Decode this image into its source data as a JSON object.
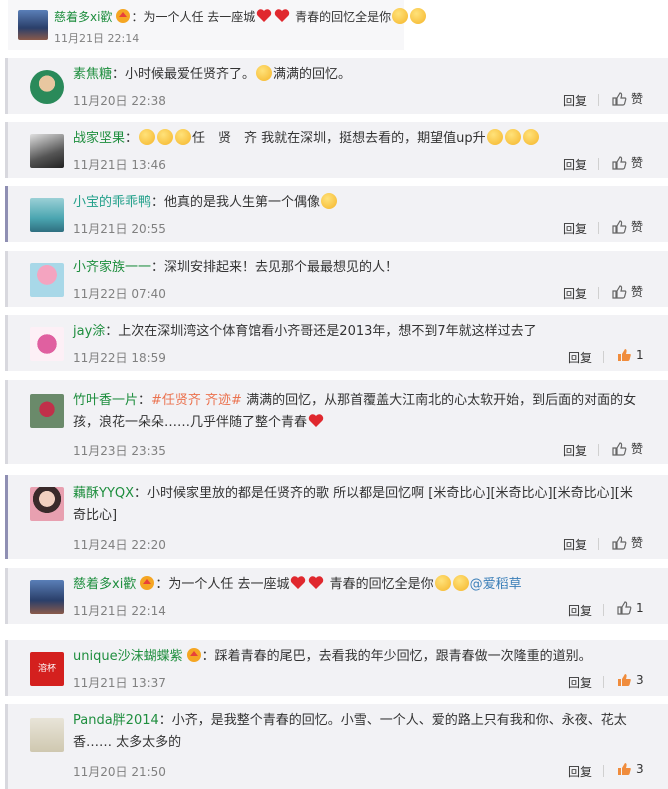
{
  "comments": [
    {
      "user": "慈着多xi歡",
      "sep": "：",
      "text_a": "为一个人任 去一座城",
      "text_b": " 青春的回忆全是你",
      "time": "11月21日 22:14"
    },
    {
      "user": "素焦糖",
      "sep": "：",
      "text_a": "小时候最爱任贤齐了。",
      "text_b": "满满的回忆。",
      "time": "11月20日 22:38",
      "reply": "回复",
      "like": "赞"
    },
    {
      "user": "战家坚果",
      "sep": "：",
      "text_a": "任　贤　齐 我就在深圳，挺想去看的，期望值up升",
      "time": "11月21日 13:46",
      "reply": "回复",
      "like": "赞"
    },
    {
      "user": "小宝的乖乖鸭",
      "sep": "：",
      "text_a": "他真的是我人生第一个偶像",
      "time": "11月21日 20:55",
      "reply": "回复",
      "like": "赞"
    },
    {
      "user": "小齐家族一一",
      "sep": "：",
      "text_a": "深圳安排起来！去见那个最最想见的人！",
      "time": "11月22日 07:40",
      "reply": "回复",
      "like": "赞"
    },
    {
      "user": "jay涂",
      "sep": "：",
      "text_a": "上次在深圳湾这个体育馆看小齐哥还是2013年，想不到7年就这样过去了",
      "time": "11月22日 18:59",
      "reply": "回复",
      "like_count": "1"
    },
    {
      "user": "竹叶香一片",
      "sep": "：",
      "tag": "#任贤齐 齐迹#",
      "text_a": " 满满的回忆，从那首覆盖大江南北的心太软开始，到后面的对面的女",
      "text_b": "孩，浪花一朵朵……几乎伴随了整个青春",
      "time": "11月23日 23:35",
      "reply": "回复",
      "like": "赞"
    },
    {
      "user": "藕酥YYQX",
      "sep": "：",
      "text_a": "小时候家里放的都是任贤齐的歌 所以都是回忆啊 [米奇比心][米奇比心][米奇比心][米",
      "text_b": "奇比心]",
      "time": "11月24日 22:20",
      "reply": "回复",
      "like": "赞"
    },
    {
      "user": "慈着多xi歡",
      "sep": "：",
      "text_a": "为一个人任 去一座城",
      "text_b": " 青春的回忆全是你",
      "mention": "@爱稻草",
      "time": "11月21日 22:14",
      "reply": "回复",
      "like_count": "1"
    },
    {
      "user": "unique沙沫蝴蝶紫",
      "sep": "：",
      "text_a": "踩着青春的尾巴，去看我的年少回忆，跟青春做一次隆重的道别。",
      "time": "11月21日 13:37",
      "reply": "回复",
      "like_count": "3",
      "avatar_text": "溶杯"
    },
    {
      "user": "Panda胖2014",
      "sep": "：",
      "text_a": "小齐，是我整个青春的回忆。小雪、一个人、爱的路上只有我和你、永夜、花太",
      "text_b": "香…… 太多太多的",
      "time": "11月20日 21:50",
      "reply": "回复",
      "like_count": "3"
    }
  ]
}
